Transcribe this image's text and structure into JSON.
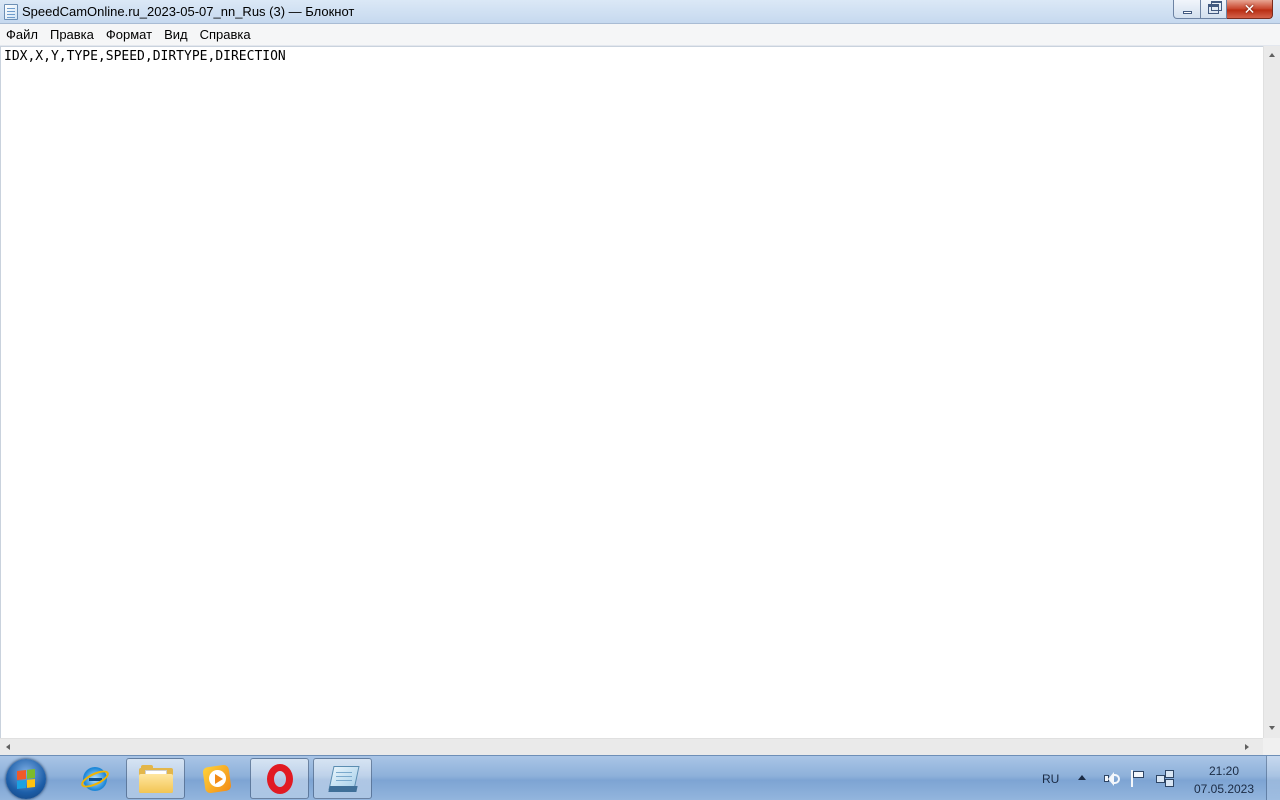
{
  "window": {
    "title": "SpeedCamOnline.ru_2023-05-07_nn_Rus (3) — Блокнот",
    "icon": "notepad-icon",
    "controls": {
      "minimize": "minimize",
      "maximize": "maximize",
      "close": "✕"
    }
  },
  "menu": [
    {
      "label": "Файл"
    },
    {
      "label": "Правка"
    },
    {
      "label": "Формат"
    },
    {
      "label": "Вид"
    },
    {
      "label": "Справка"
    }
  ],
  "editor": {
    "content": "IDX,X,Y,TYPE,SPEED,DIRTYPE,DIRECTION"
  },
  "taskbar": {
    "start_icon": "windows-start-icon",
    "apps": [
      {
        "name": "internet-explorer-icon",
        "state": "pinned"
      },
      {
        "name": "file-explorer-icon",
        "state": "active"
      },
      {
        "name": "media-player-icon",
        "state": "pinned"
      },
      {
        "name": "opera-icon",
        "state": "active"
      },
      {
        "name": "notepad-icon",
        "state": "active"
      }
    ],
    "tray": {
      "language": "RU",
      "time": "21:20",
      "date": "07.05.2023"
    }
  }
}
